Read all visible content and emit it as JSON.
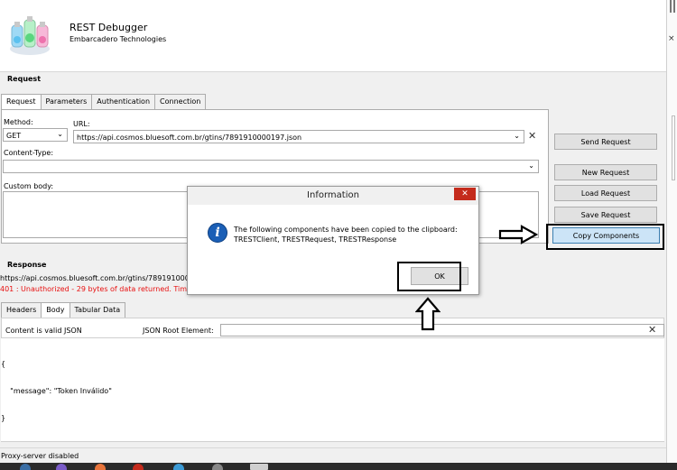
{
  "app": {
    "title": "REST Debugger",
    "subtitle": "Embarcadero Technologies",
    "logo_icon": "flask-bottles-icon"
  },
  "side_strip": {
    "close_glyph": "×"
  },
  "request": {
    "section_title": "Request",
    "tabs": [
      {
        "label": "Request",
        "active": true
      },
      {
        "label": "Parameters",
        "active": false
      },
      {
        "label": "Authentication",
        "active": false
      },
      {
        "label": "Connection",
        "active": false
      }
    ],
    "method_label": "Method:",
    "method_value": "GET",
    "url_label": "URL:",
    "url_value": "https://api.cosmos.bluesoft.com.br/gtins/7891910000197.json",
    "clear_glyph": "✕",
    "content_type_label": "Content-Type:",
    "content_type_value": "",
    "custom_body_label": "Custom body:",
    "custom_body_value": ""
  },
  "actions": {
    "send_request": "Send Request",
    "new_request": "New Request",
    "load_request": "Load Request",
    "save_request": "Save Request",
    "copy_components": "Copy Components"
  },
  "response": {
    "section_title": "Response",
    "url_line": "https://api.cosmos.bluesoft.com.br/gtins/78919100001",
    "status_line": "401 : Unauthorized - 29 bytes of data returned. Timing:",
    "status_color": "#e81010",
    "tabs": [
      {
        "label": "Headers",
        "active": false
      },
      {
        "label": "Body",
        "active": true
      },
      {
        "label": "Tabular Data",
        "active": false
      }
    ],
    "valid_json_label": "Content is valid JSON",
    "json_root_label": "JSON Root Element:",
    "json_root_value": "",
    "clear_glyph": "✕",
    "body_lines": [
      "{",
      "    \"message\": \"Token Inválido\"",
      "}"
    ]
  },
  "status_bar": {
    "text": "Proxy-server disabled"
  },
  "dialog": {
    "title": "Information",
    "close_glyph": "✕",
    "icon": "info-icon",
    "icon_glyph": "i",
    "message_line1": "The following components have been copied to the clipboard:",
    "message_line2": "TRESTClient, TRESTRequest, TRESTResponse",
    "ok_label": "OK"
  },
  "annotations": {
    "arrow_right_icon": "hollow-arrow-right-icon",
    "arrow_up_icon": "hollow-arrow-up-icon"
  },
  "taskbar": {
    "icons": [
      {
        "name": "taskbar-app-icon-1",
        "color": "#3a6ea5"
      },
      {
        "name": "taskbar-app-icon-2",
        "color": "#7a5cc8"
      },
      {
        "name": "taskbar-app-icon-3",
        "color": "#e8743b"
      },
      {
        "name": "taskbar-app-icon-4",
        "color": "#c42b1c"
      },
      {
        "name": "taskbar-app-icon-5",
        "color": "#3c9bd6"
      },
      {
        "name": "taskbar-app-icon-6",
        "color": "#888888"
      },
      {
        "name": "taskbar-app-icon-7",
        "color": "#cfcfcf"
      }
    ]
  }
}
